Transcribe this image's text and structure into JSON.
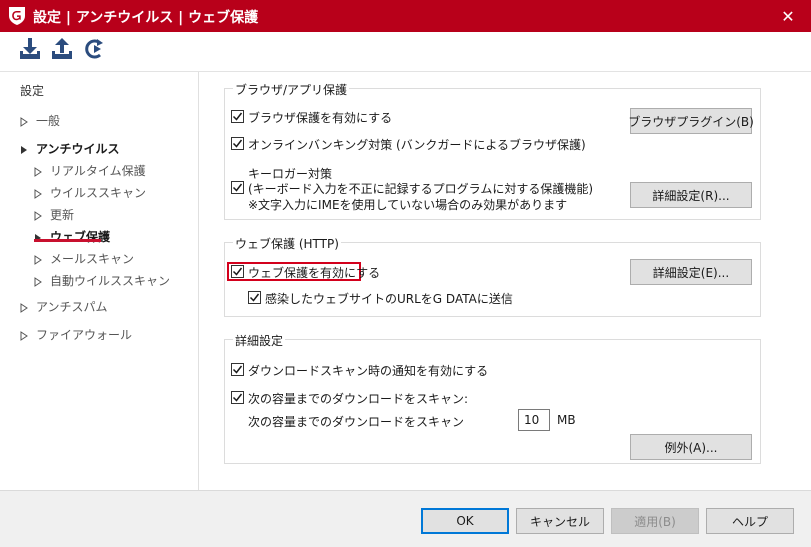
{
  "window": {
    "title": "設定 | アンチウイルス | ウェブ保護",
    "logo_icon": "g-data-shield-icon",
    "close_glyph": "✕",
    "title_bar_color": "#b8001a"
  },
  "toolbar": {
    "buttons": [
      {
        "name": "import-settings-button",
        "icon": "download-tray-icon"
      },
      {
        "name": "export-settings-button",
        "icon": "upload-tray-icon"
      },
      {
        "name": "reset-settings-button",
        "icon": "reset-arrow-icon"
      }
    ],
    "icon_color": "#2b4c7e"
  },
  "sidebar": {
    "title": "設定",
    "items": [
      {
        "label": "一般",
        "level": 0
      },
      {
        "label": "アンチウイルス",
        "level": 0,
        "expanded": true
      },
      {
        "label": "リアルタイム保護",
        "level": 1
      },
      {
        "label": "ウイルススキャン",
        "level": 1
      },
      {
        "label": "更新",
        "level": 1
      },
      {
        "label": "ウェブ保護",
        "level": 1,
        "selected": true
      },
      {
        "label": "メールスキャン",
        "level": 1
      },
      {
        "label": "自動ウイルススキャン",
        "level": 1
      },
      {
        "label": "アンチスパム",
        "level": 0
      },
      {
        "label": "ファイアウォール",
        "level": 0
      }
    ],
    "selected_underline_color": "#c8102e"
  },
  "browser_group": {
    "title": "ブラウザ/アプリ保護",
    "enable_browser": {
      "label": "ブラウザ保護を有効にする",
      "checked": true
    },
    "online_banking": {
      "label": "オンラインバンキング対策 (バンクガードによるブラウザ保護)",
      "checked": true
    },
    "keylogger_heading": "キーロガー対策",
    "keylogger": {
      "label": "(キーボード入力を不正に記録するプログラムに対する保護機能)",
      "checked": true
    },
    "keylogger_note": "※文字入力にIMEを使用していない場合のみ効果があります",
    "plugin_button": "ブラウザプラグイン(B)",
    "advanced_button": "詳細設定(R)..."
  },
  "web_group": {
    "title": "ウェブ保護 (HTTP)",
    "enable_web": {
      "label": "ウェブ保護を有効にする",
      "checked": true
    },
    "send_urls": {
      "label": "感染したウェブサイトのURLをG DATAに送信",
      "checked": true
    },
    "advanced_button": "詳細設定(E)...",
    "highlight_color": "#d3001c"
  },
  "advanced_group": {
    "title": "詳細設定",
    "download_notify": {
      "label": "ダウンロードスキャン時の通知を有効にする",
      "checked": true
    },
    "size_limit": {
      "label": "次の容量までのダウンロードをスキャン:",
      "checked": true
    },
    "size_row_label": "次の容量までのダウンロードをスキャン",
    "size_value": "10",
    "size_unit": "MB",
    "exceptions_button": "例外(A)..."
  },
  "footer": {
    "ok": "OK",
    "cancel": "キャンセル",
    "apply": "適用(B)",
    "help": "ヘルプ"
  }
}
